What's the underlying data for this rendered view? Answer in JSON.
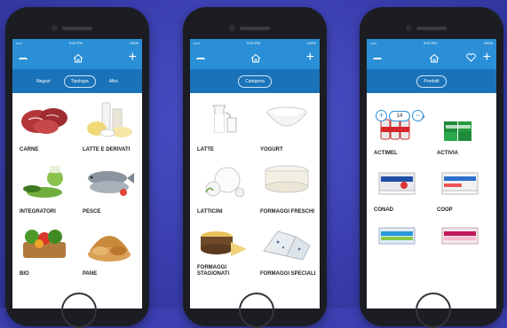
{
  "status": {
    "carrier": "•••••",
    "time": "9:00 PM",
    "battery": "100%"
  },
  "icons": {
    "menu": "menu-icon",
    "home": "home-icon",
    "add": "plus-icon",
    "favorite": "heart-icon",
    "edit": "pencil-icon"
  },
  "colors": {
    "nav": "#2a8fd6",
    "subnav": "#1a73b8",
    "background": "#3b3fb0"
  },
  "phone1": {
    "tabs": [
      {
        "label": "Negozi"
      },
      {
        "label": "Tipologia"
      },
      {
        "label": "Altro"
      }
    ],
    "items": [
      {
        "label": "CARNE"
      },
      {
        "label": "LATTE E DERIVATI"
      },
      {
        "label": "INTEGRATORI"
      },
      {
        "label": "PESCE"
      },
      {
        "label": "BIO"
      },
      {
        "label": "PANE"
      }
    ]
  },
  "phone2": {
    "tabs": [
      {
        "label": "Categoria"
      }
    ],
    "items": [
      {
        "label": "LATTE"
      },
      {
        "label": "YOGURT"
      },
      {
        "label": "LATTICINI"
      },
      {
        "label": "FORMAGGI FRESCHI"
      },
      {
        "label": "FORMAGGI STAGIONATI"
      },
      {
        "label": "FORMAGGI SPECIALI"
      }
    ]
  },
  "phone3": {
    "tabs": [
      {
        "label": "Prodotti"
      }
    ],
    "quantity": "14",
    "items": [
      {
        "label": "ACTIMEL"
      },
      {
        "label": "ACTIVIA"
      },
      {
        "label": "CONAD"
      },
      {
        "label": "COOP"
      },
      {
        "label": ""
      },
      {
        "label": ""
      }
    ]
  }
}
